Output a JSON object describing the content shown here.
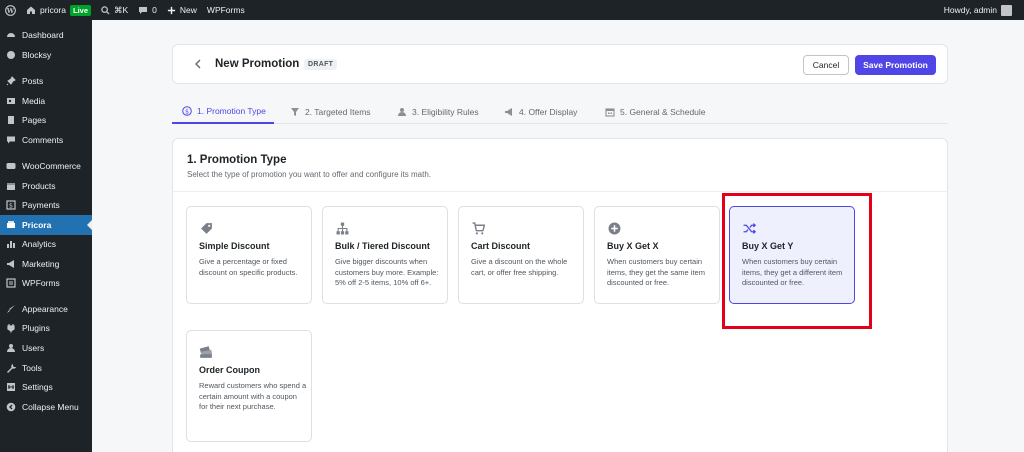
{
  "adminbar": {
    "site": "pricora",
    "live": "Live",
    "shortcut": "⌘K",
    "comments": "0",
    "new": "New",
    "wpforms": "WPForms",
    "howdy": "Howdy, admin"
  },
  "sidebar": {
    "items": [
      {
        "label": "Dashboard"
      },
      {
        "label": "Blocksy"
      },
      {
        "label": "Posts"
      },
      {
        "label": "Media"
      },
      {
        "label": "Pages"
      },
      {
        "label": "Comments"
      },
      {
        "label": "WooCommerce"
      },
      {
        "label": "Products"
      },
      {
        "label": "Payments"
      },
      {
        "label": "Pricora"
      },
      {
        "label": "Analytics"
      },
      {
        "label": "Marketing"
      },
      {
        "label": "WPForms"
      },
      {
        "label": "Appearance"
      },
      {
        "label": "Plugins"
      },
      {
        "label": "Users"
      },
      {
        "label": "Tools"
      },
      {
        "label": "Settings"
      },
      {
        "label": "Collapse Menu"
      }
    ]
  },
  "header": {
    "title": "New Promotion",
    "badge": "DRAFT",
    "cancel": "Cancel",
    "save": "Save Promotion"
  },
  "tabs": [
    {
      "label": "1. Promotion Type",
      "icon": "dollar-circle-icon"
    },
    {
      "label": "2. Targeted Items",
      "icon": "filter-icon"
    },
    {
      "label": "3. Eligibility Rules",
      "icon": "user-icon"
    },
    {
      "label": "4. Offer Display",
      "icon": "megaphone-icon"
    },
    {
      "label": "5. General & Schedule",
      "icon": "calendar-icon"
    }
  ],
  "section": {
    "title": "1. Promotion Type",
    "desc": "Select the type of promotion you want to offer and configure its math."
  },
  "types": [
    {
      "title": "Simple Discount",
      "desc": "Give a percentage or fixed discount on specific products.",
      "icon": "tag-icon"
    },
    {
      "title": "Bulk / Tiered Discount",
      "desc": "Give bigger discounts when customers buy more. Example: 5% off 2-5 items, 10% off 6+.",
      "icon": "hierarchy-icon"
    },
    {
      "title": "Cart Discount",
      "desc": "Give a discount on the whole cart, or offer free shipping.",
      "icon": "cart-icon"
    },
    {
      "title": "Buy X Get X",
      "desc": "When customers buy certain items, they get the same item discounted or free.",
      "icon": "plus-circle-icon"
    },
    {
      "title": "Buy X Get Y",
      "desc": "When customers buy certain items, they get a different item discounted or free.",
      "icon": "shuffle-icon"
    },
    {
      "title": "Order Coupon",
      "desc": "Reward customers who spend a certain amount with a coupon for their next purchase.",
      "icon": "coupon-icon"
    }
  ],
  "colors": {
    "accent": "#4f46e5",
    "highlight": "#e3001b",
    "sidebar_bg": "#1d2327",
    "active_menu": "#2271b1"
  }
}
